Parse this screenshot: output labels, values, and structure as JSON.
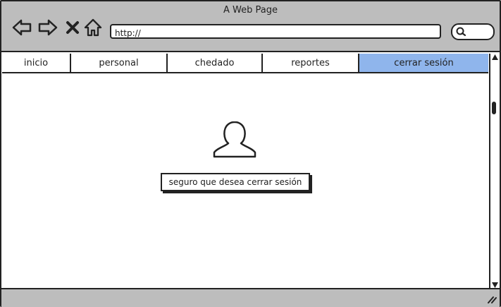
{
  "window": {
    "title": "A Web Page",
    "url": "http://"
  },
  "toolbar": {
    "icons": [
      "back-arrow-icon",
      "forward-arrow-icon",
      "close-x-icon",
      "home-icon",
      "search-icon"
    ]
  },
  "nav": {
    "tabs": [
      {
        "label": "inicio",
        "active": false
      },
      {
        "label": "personal",
        "active": false
      },
      {
        "label": "chedado",
        "active": false
      },
      {
        "label": "reportes",
        "active": false
      },
      {
        "label": "cerrar sesión",
        "active": true
      }
    ]
  },
  "main": {
    "icon": "user-icon",
    "confirm_label": "seguro que desea cerrar sesión"
  },
  "colors": {
    "chrome": "#bdbdbd",
    "active_tab": "#8fb5ec",
    "stroke": "#222222"
  }
}
